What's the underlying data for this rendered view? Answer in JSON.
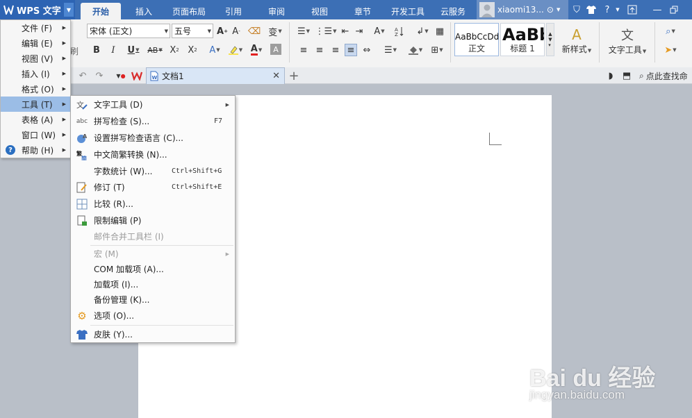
{
  "app": {
    "name": "WPS 文字"
  },
  "tabs": [
    {
      "label": "开始",
      "active": true
    },
    {
      "label": "插入"
    },
    {
      "label": "页面布局"
    },
    {
      "label": "引用"
    },
    {
      "label": "审阅"
    },
    {
      "label": "视图"
    },
    {
      "label": "章节"
    },
    {
      "label": "开发工具"
    },
    {
      "label": "云服务"
    }
  ],
  "user": {
    "name": "xiaomi13..."
  },
  "ribbon": {
    "font_name": "宋体 (正文)",
    "font_size": "五号",
    "styles": [
      {
        "sample": "AaBbCcDd",
        "name": "正文"
      },
      {
        "sample": "AaBb",
        "name": "标题 1"
      }
    ],
    "new_style": "新样式",
    "text_tools": "文字工具"
  },
  "doc_tab": {
    "title": "文档1"
  },
  "search": {
    "label": "点此查找命"
  },
  "app_menu": [
    {
      "label": "文件 (F)"
    },
    {
      "label": "编辑 (E)"
    },
    {
      "label": "视图 (V)"
    },
    {
      "label": "插入 (I)"
    },
    {
      "label": "格式 (O)"
    },
    {
      "label": "工具 (T)",
      "selected": true
    },
    {
      "label": "表格 (A)"
    },
    {
      "label": "窗口 (W)"
    },
    {
      "label": "帮助 (H)"
    }
  ],
  "tools_menu": [
    {
      "label": "文字工具 (D)",
      "icon": "text-tools-icon",
      "submenu": true
    },
    {
      "label": "拼写检查 (S)...",
      "icon": "spellcheck-icon",
      "shortcut": "F7"
    },
    {
      "label": "设置拼写检查语言 (C)...",
      "icon": "spell-language-icon"
    },
    {
      "label": "中文简繁转换 (N)...",
      "icon": "chinese-convert-icon"
    },
    {
      "label": "字数统计 (W)...",
      "shortcut": "Ctrl+Shift+G"
    },
    {
      "label": "修订 (T)",
      "icon": "revision-icon",
      "shortcut": "Ctrl+Shift+E"
    },
    {
      "label": "比较 (R)...",
      "icon": "compare-icon"
    },
    {
      "label": "限制编辑 (P)",
      "icon": "restrict-edit-icon"
    },
    {
      "label": "邮件合并工具栏 (I)",
      "disabled": true
    },
    {
      "label": "宏 (M)",
      "disabled": true,
      "submenu": true
    },
    {
      "label": "COM 加载项 (A)..."
    },
    {
      "label": "加载项 (I)..."
    },
    {
      "label": "备份管理 (K)..."
    },
    {
      "label": "选项 (O)...",
      "icon": "options-gear-icon"
    },
    {
      "label": "皮肤 (Y)...",
      "icon": "skin-shirt-icon"
    }
  ],
  "watermark": {
    "brand": "Bai du 经验",
    "url": "jingyan.baidu.com"
  }
}
